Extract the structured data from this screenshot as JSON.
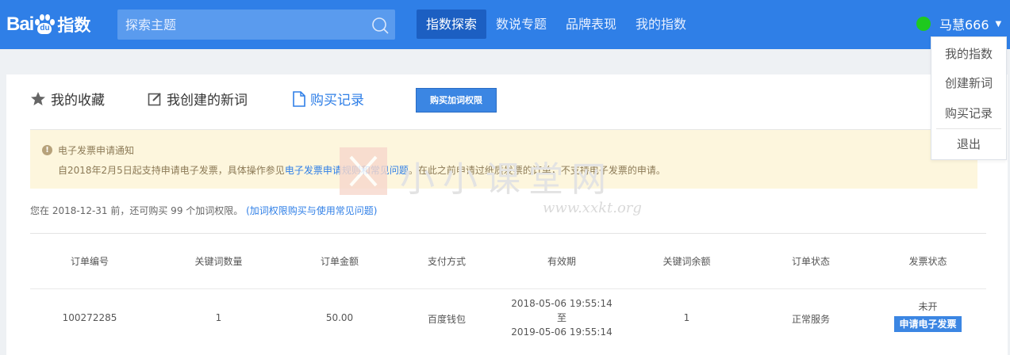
{
  "brand": {
    "logo_bai": "Bai",
    "logo_du": "du",
    "logo_product": "指数"
  },
  "search": {
    "placeholder": "探索主题"
  },
  "nav": {
    "tabs": [
      {
        "label": "指数探索",
        "active": true
      },
      {
        "label": "数说专题"
      },
      {
        "label": "品牌表现"
      },
      {
        "label": "我的指数"
      }
    ]
  },
  "user": {
    "name": "马慧666",
    "status_color": "#1ec91e"
  },
  "user_menu": {
    "items": [
      "我的指数",
      "创建新词",
      "购买记录",
      "退出"
    ]
  },
  "subtabs": {
    "favorites": "我的收藏",
    "created": "我创建的新词",
    "purchases": "购买记录",
    "buy_button": "购买加词权限"
  },
  "notice": {
    "title": "电子发票申请通知",
    "body_prefix": "自2018年2月5日起支持申请电子发票，具体操作参见",
    "body_link": "电子发票申请规则和常见问题",
    "body_suffix": "。在此之前申请过纸质发票的订单，不支持电子发票的申请。"
  },
  "quota": {
    "text": "您在 2018-12-31 前，还可购买 99 个加词权限。",
    "link": "(加词权限购买与使用常见问题)"
  },
  "table": {
    "headers": [
      "订单编号",
      "关键词数量",
      "订单金额",
      "支付方式",
      "有效期",
      "关键词余额",
      "订单状态",
      "发票状态"
    ],
    "rows": [
      {
        "order_id": "100272285",
        "keyword_count": "1",
        "amount": "50.00",
        "payment": "百度钱包",
        "valid_from": "2018-05-06 19:55:14",
        "valid_sep": "至",
        "valid_to": "2019-05-06 19:55:14",
        "keyword_balance": "1",
        "status": "正常服务",
        "invoice_status": "未开",
        "invoice_button": "申请电子发票"
      }
    ]
  },
  "watermark": {
    "text": "小小课堂网",
    "url": "www.xxkt.org"
  },
  "colors": {
    "header": "#2f7fe7",
    "active_tab": "#1c5fc2",
    "notice_bg": "#fdf6dd",
    "link": "#2f7fe7"
  }
}
